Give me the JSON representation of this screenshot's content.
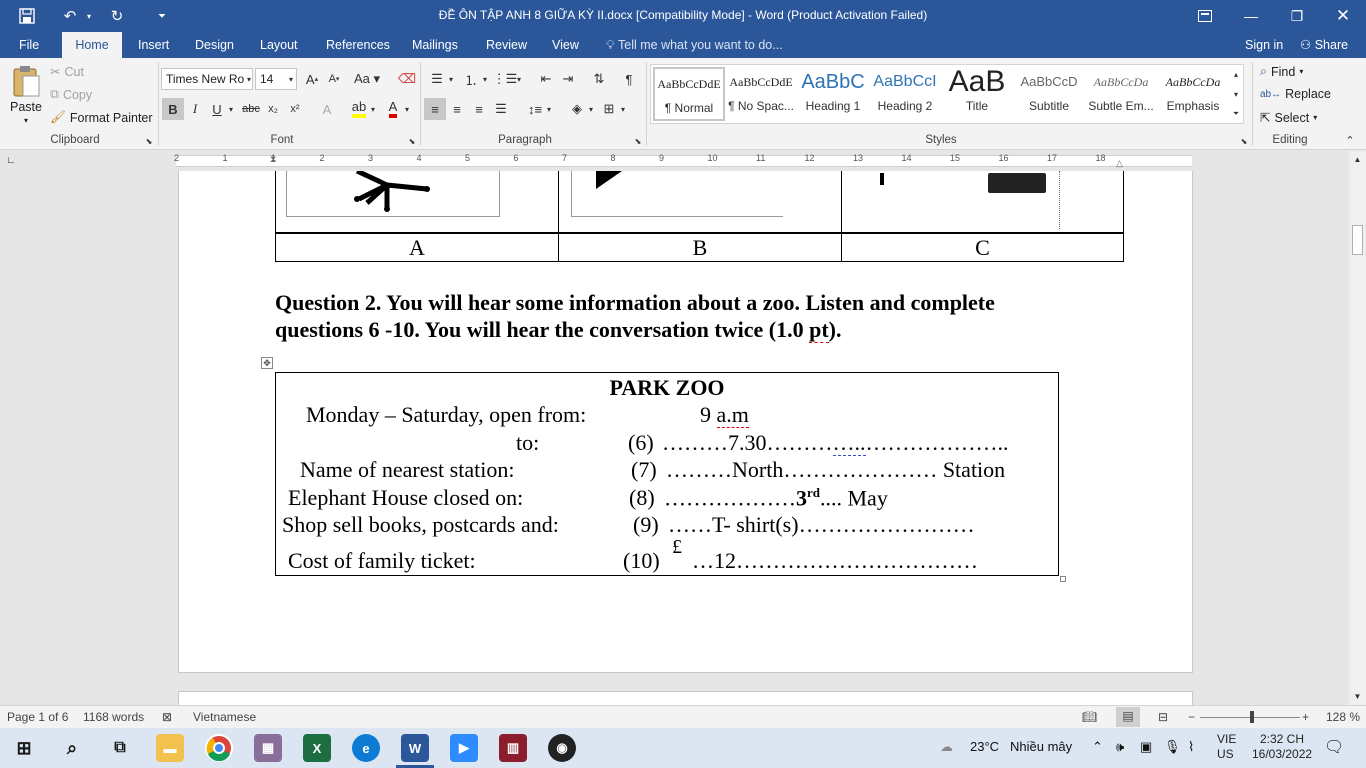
{
  "window": {
    "title": "ĐỀ ÔN TẬP  ANH 8 GIỮA  KỲ II.docx [Compatibility Mode] - Word (Product Activation Failed)"
  },
  "tabs": {
    "file": "File",
    "home": "Home",
    "insert": "Insert",
    "design": "Design",
    "layout": "Layout",
    "references": "References",
    "mailings": "Mailings",
    "review": "Review",
    "view": "View",
    "tellme": "Tell me what you want to do...",
    "signin": "Sign in",
    "share": "Share"
  },
  "clipboard": {
    "paste": "Paste",
    "cut": "Cut",
    "copy": "Copy",
    "format_painter": "Format Painter",
    "label": "Clipboard"
  },
  "font": {
    "name": "Times New Ro",
    "size": "14",
    "label": "Font"
  },
  "paragraph": {
    "label": "Paragraph"
  },
  "styles": {
    "label": "Styles",
    "items": [
      {
        "preview": "AaBbCcDdE",
        "name": "¶ Normal"
      },
      {
        "preview": "AaBbCcDdE",
        "name": "¶ No Spac..."
      },
      {
        "preview": "AaBbC",
        "name": "Heading 1"
      },
      {
        "preview": "AaBbCcI",
        "name": "Heading 2"
      },
      {
        "preview": "AaB",
        "name": "Title"
      },
      {
        "preview": "AaBbCcD",
        "name": "Subtitle"
      },
      {
        "preview": "AaBbCcDa",
        "name": "Subtle Em..."
      },
      {
        "preview": "AaBbCcDa",
        "name": "Emphasis"
      }
    ]
  },
  "editing": {
    "find": "Find",
    "replace": "Replace",
    "select": "Select",
    "label": "Editing"
  },
  "ruler": {
    "numbers": [
      "2",
      "1",
      "1",
      "2",
      "3",
      "4",
      "5",
      "6",
      "7",
      "8",
      "9",
      "10",
      "11",
      "12",
      "13",
      "14",
      "15",
      "16",
      "17",
      "18"
    ]
  },
  "document": {
    "options": [
      "A",
      "B",
      "C"
    ],
    "question2_line1": "Question 2. You will hear some information about a zoo. Listen and complete",
    "question2_line2a": "questions 6 -10. You will hear the conversation twice (1.0 ",
    "question2_pt": "pt",
    "question2_line2b": ").",
    "zoo": {
      "title": "PARK ZOO",
      "r1_label": "Monday – Saturday, open from:",
      "r1_value_a": "9 ",
      "r1_value_b": "a.m",
      "r2_label": "to:",
      "r2_num": "(6)",
      "r2_fill_a": "………7.30………",
      "r2_fill_b": "…..",
      "r2_fill_c": "………………..",
      "r3_label": "Name of nearest station:",
      "r3_num": "(7)",
      "r3_fill": "………North………………… Station",
      "r4_label": "Elephant House closed on:",
      "r4_num": "(8)",
      "r4_fill_a": "………………",
      "r4_fill_b": "3",
      "r4_fill_sup": "rd",
      "r4_fill_c": ".... May",
      "r5_label": "Shop sell books, postcards and:",
      "r5_num": "(9)",
      "r5_fill": "……T- shirt(s)……………………",
      "r6_label": "Cost of family ticket:",
      "r6_num": "(10)",
      "r6_currency": "£",
      "r6_fill": "…12……………………………"
    }
  },
  "statusbar": {
    "page": "Page 1 of 6",
    "words": "1168 words",
    "language": "Vietnamese",
    "zoom": "128 %"
  },
  "taskbar": {
    "weather_temp": "23°C",
    "weather_text": "Nhiều mây",
    "lang_top": "VIE",
    "lang_bottom": "US",
    "time": "2:32 CH",
    "date": "16/03/2022"
  },
  "colors": {
    "word_blue": "#2b579a",
    "ribbon": "#f3f3f3",
    "page_bg": "#e6e6e6"
  }
}
